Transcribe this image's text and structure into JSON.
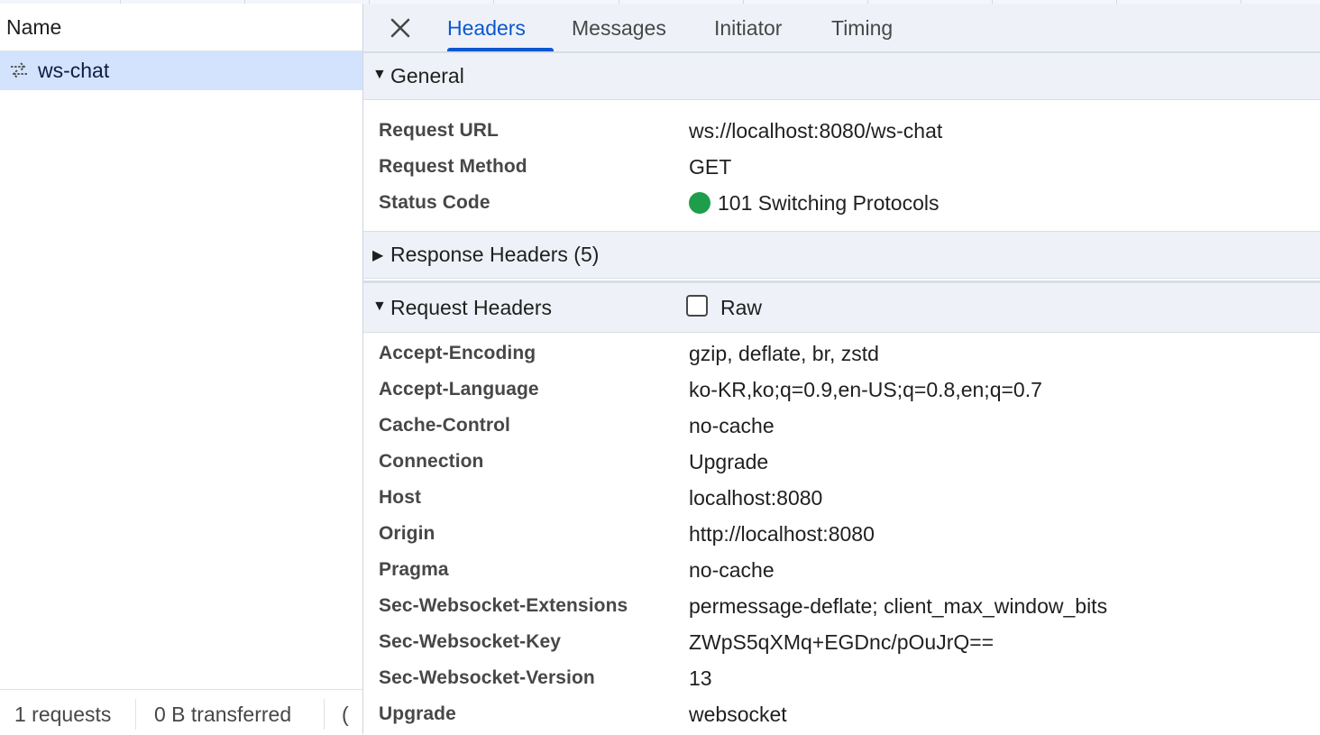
{
  "network_list": {
    "column_header": "Name",
    "rows": [
      {
        "name": "ws-chat",
        "icon": "websocket-arrows-icon",
        "selected": true
      }
    ],
    "status_bar": {
      "requests": "1 requests",
      "transferred": "0 B transferred",
      "truncated": "("
    }
  },
  "detail_tabs": {
    "close_icon": "close-icon",
    "tabs": [
      {
        "label": "Headers",
        "active": true
      },
      {
        "label": "Messages",
        "active": false
      },
      {
        "label": "Initiator",
        "active": false
      },
      {
        "label": "Timing",
        "active": false
      }
    ]
  },
  "general": {
    "title": "General",
    "expanded": true,
    "rows": [
      {
        "key": "Request URL",
        "value": "ws://localhost:8080/ws-chat"
      },
      {
        "key": "Request Method",
        "value": "GET"
      },
      {
        "key": "Status Code",
        "value": "101 Switching Protocols",
        "status_color": "#1e9e4a"
      }
    ]
  },
  "response_headers": {
    "title": "Response Headers (5)",
    "expanded": false
  },
  "request_headers": {
    "title": "Request Headers",
    "expanded": true,
    "raw_label": "Raw",
    "raw_checked": false,
    "rows": [
      {
        "key": "Accept-Encoding",
        "value": "gzip, deflate, br, zstd"
      },
      {
        "key": "Accept-Language",
        "value": "ko-KR,ko;q=0.9,en-US;q=0.8,en;q=0.7"
      },
      {
        "key": "Cache-Control",
        "value": "no-cache"
      },
      {
        "key": "Connection",
        "value": "Upgrade"
      },
      {
        "key": "Host",
        "value": "localhost:8080"
      },
      {
        "key": "Origin",
        "value": "http://localhost:8080"
      },
      {
        "key": "Pragma",
        "value": "no-cache"
      },
      {
        "key": "Sec-Websocket-Extensions",
        "value": "permessage-deflate; client_max_window_bits"
      },
      {
        "key": "Sec-Websocket-Key",
        "value": "ZWpS5qXMq+EGDnc/pOuJrQ=="
      },
      {
        "key": "Sec-Websocket-Version",
        "value": "13"
      },
      {
        "key": "Upgrade",
        "value": "websocket"
      }
    ]
  },
  "colors": {
    "accent": "#0b57d0",
    "selected_row": "#d3e3fd",
    "section_bg": "#eef2f8"
  }
}
